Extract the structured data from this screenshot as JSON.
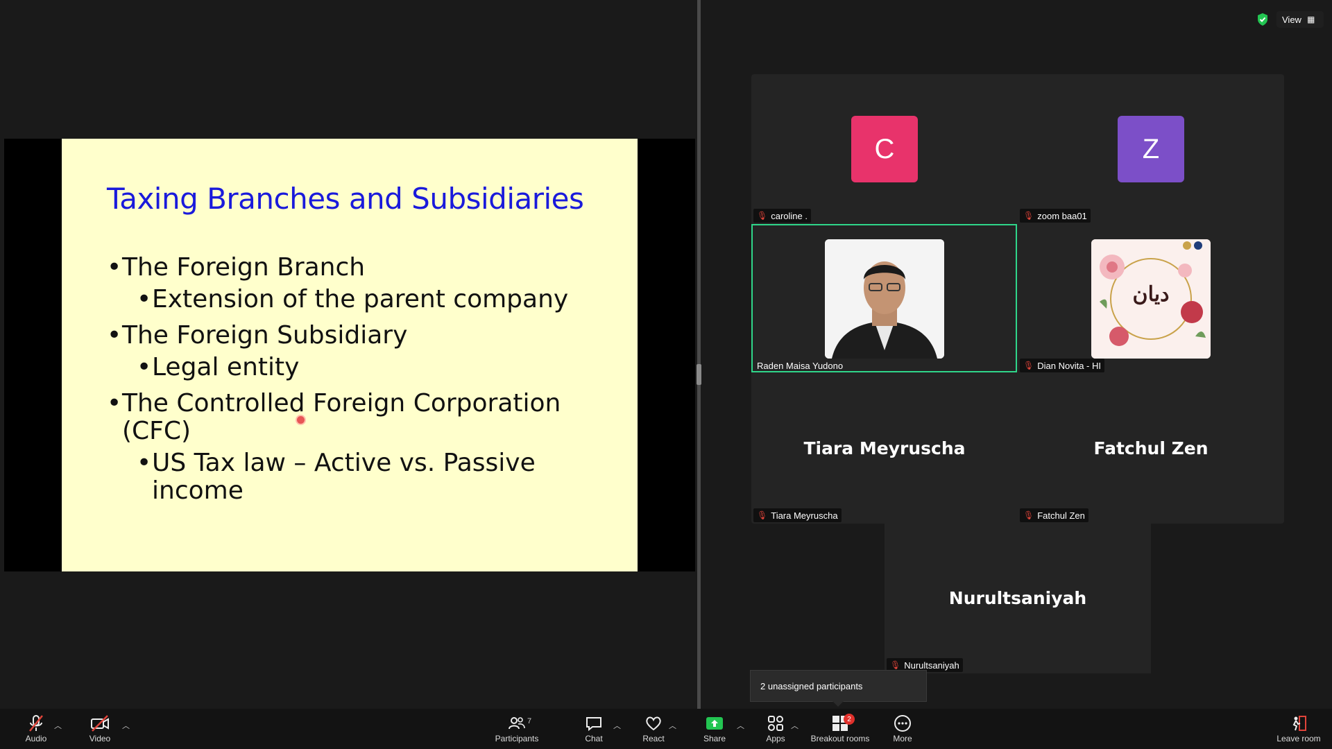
{
  "slide": {
    "title": "Taxing Branches and Subsidiaries",
    "bullets": [
      {
        "level": 1,
        "text": "The Foreign Branch"
      },
      {
        "level": 2,
        "text": "Extension of the parent company"
      },
      {
        "level": 1,
        "text": "The Foreign Subsidiary"
      },
      {
        "level": 2,
        "text": "Legal entity"
      },
      {
        "level": 1,
        "text": "The Controlled Foreign Corporation"
      },
      {
        "level": 1,
        "text": "(CFC)"
      },
      {
        "level": 2,
        "text": "US Tax law – Active vs. Passive"
      },
      {
        "level": 2,
        "text": "income"
      }
    ]
  },
  "top_right": {
    "view_label": "View"
  },
  "participants": [
    {
      "name": "caroline .",
      "avatar_letter": "C",
      "avatar_color": "#e8336b"
    },
    {
      "name": "zoom baa01",
      "avatar_letter": "Z",
      "avatar_color": "#7c4fc8"
    },
    {
      "name": "Raden Maisa Yudono"
    },
    {
      "name": "Dian Novita - HI",
      "image_text": "ديان"
    },
    {
      "name": "Tiara Meyruscha",
      "display_name": "Tiara Meyruscha"
    },
    {
      "name": "Fatchul Zen",
      "display_name": "Fatchul Zen"
    },
    {
      "name": "Nurultsaniyah",
      "display_name": "Nurultsaniyah"
    }
  ],
  "unassigned_popup": "2 unassigned participants",
  "toolbar": {
    "audio": "Audio",
    "video": "Video",
    "participants": "Participants",
    "participants_count": "7",
    "chat": "Chat",
    "react": "React",
    "share": "Share",
    "apps": "Apps",
    "breakout": "Breakout rooms",
    "breakout_badge": "2",
    "more": "More",
    "leave": "Leave room"
  },
  "colors": {
    "active_speaker_border": "#2fd68a",
    "share_green": "#23c552",
    "muted_red": "#e0443a"
  }
}
